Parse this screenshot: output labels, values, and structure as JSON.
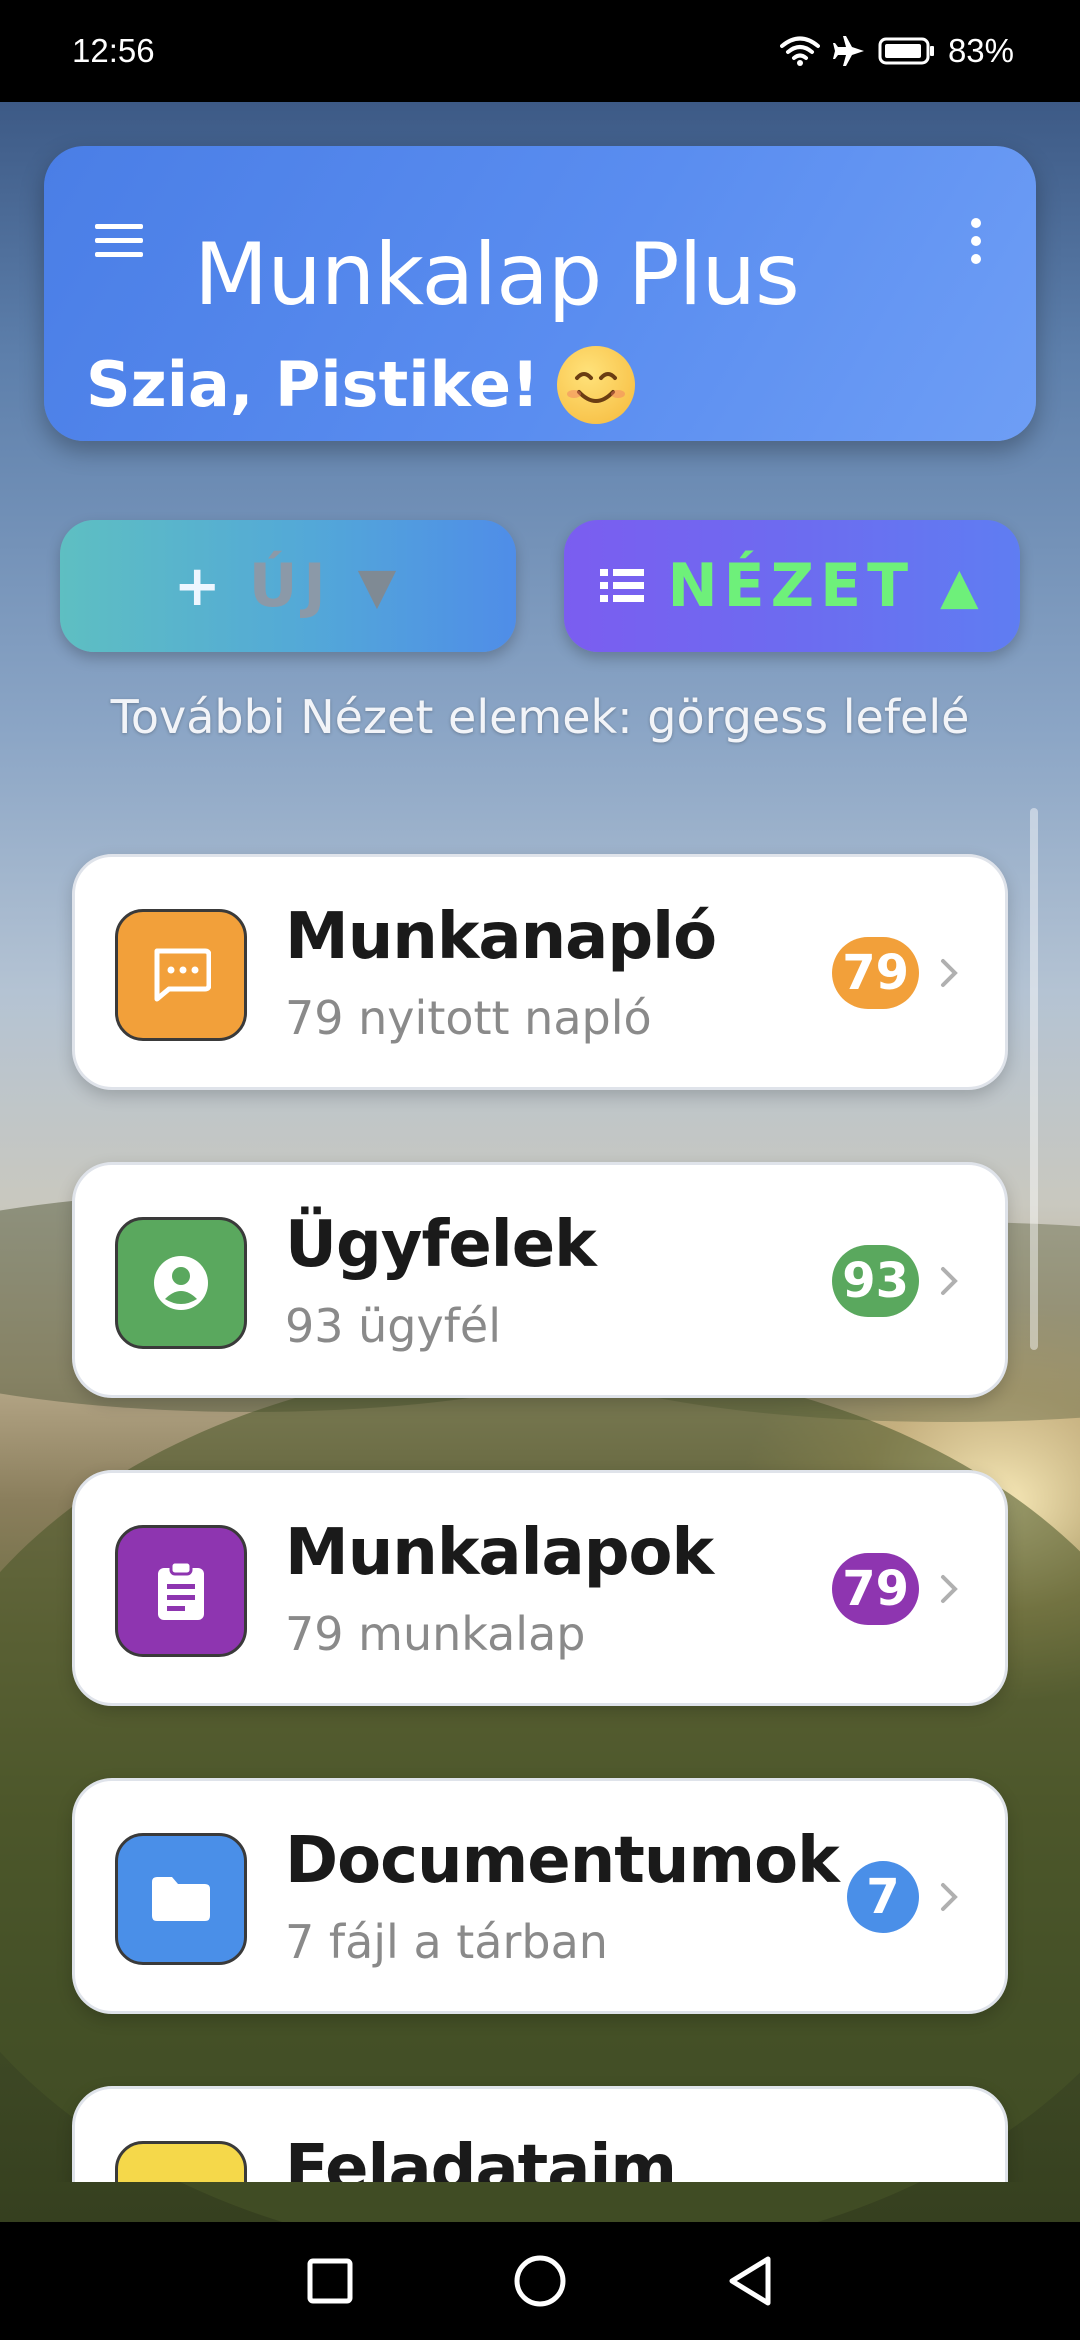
{
  "status_bar": {
    "time": "12:56",
    "battery": "83%",
    "icons": [
      "wifi-icon",
      "airplane-icon",
      "battery-icon"
    ]
  },
  "header": {
    "title": "Munkalap Plus",
    "greeting": "Szia, Pistike!",
    "greeting_emoji": "smiley-emoji",
    "color": "#5a8df0"
  },
  "actions": {
    "new_plus": "+",
    "new_label": "ÚJ",
    "new_caret": "▼",
    "view_label": "NÉZET",
    "view_caret": "▲",
    "view_text_color": "#6ef07a"
  },
  "hint": "További Nézet elemek: görgess lefelé",
  "list": [
    {
      "title": "Munkanapló",
      "subtitle": "79 nyitott napló",
      "badge": "79",
      "icon": "chat-icon",
      "color": "#f2a03a"
    },
    {
      "title": "Ügyfelek",
      "subtitle": "93 ügyfél",
      "badge": "93",
      "icon": "person-icon",
      "color": "#5aa85e"
    },
    {
      "title": "Munkalapok",
      "subtitle": "79 munkalap",
      "badge": "79",
      "icon": "clipboard-icon",
      "color": "#8e35b0"
    },
    {
      "title": "Documentumok",
      "subtitle": "7 fájl a tárban",
      "badge": "7",
      "icon": "folder-icon",
      "color": "#4a8fe8"
    },
    {
      "title": "Feladataim",
      "subtitle": "",
      "badge": "",
      "icon": "task-icon",
      "color": "#f5d84a"
    }
  ],
  "nav_bar": [
    "recents-button",
    "home-button",
    "back-button"
  ]
}
